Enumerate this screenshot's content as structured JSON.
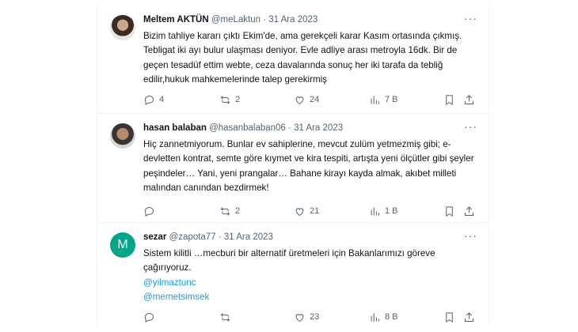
{
  "tweets": [
    {
      "name": "Meltem AKTÜN",
      "handle": "@meLaktun",
      "dot": "·",
      "date": "31 Ara 2023",
      "more": "···",
      "text": "Bizim tahliye kararı çıktı Ekim'de, ama gerekçeli karar Kasım ortasında çıkmış. Tebligat iki ayı bulur ulaşması deniyor. Evle adliye arası metroyla 16dk. Bir de geçen tesadüf ettim webte, ceza davalarında sonuç her iki tarafa da tebliğ edilir,hukuk mahkemelerinde talep gerekirmiş",
      "replies": "4",
      "reposts": "2",
      "likes": "24",
      "views": "7 B"
    },
    {
      "name": "hasan balaban",
      "handle": "@hasanbalaban06",
      "dot": "·",
      "date": "31 Ara 2023",
      "more": "···",
      "text": "Hiç zannetmiyorum.  Bunlar ev sahiplerine, mevcut zulüm yetmezmiş gibi; e-devletten kontrat, semte göre kıymet ve kira tespiti, artışta yeni ölçütler gibi şeyler peşindeler… Yani, yeni prangalar… Bahane kirayı kayda almak, akıbet milleti malından canından bezdirmek!",
      "replies": "",
      "reposts": "2",
      "likes": "21",
      "views": "1 B"
    },
    {
      "name": "sezar",
      "handle": "@zapota77",
      "dot": "·",
      "date": "31 Ara 2023",
      "more": "···",
      "avatar_letter": "M",
      "text": "Sistem kilitli …mecburi bir alternatif üretmeleri için Bakanlarımızı göreve çağırıyoruz.",
      "mentions": [
        "@yilmaztunc",
        "@memetsimsek"
      ],
      "replies": "",
      "reposts": "",
      "likes": "23",
      "views": "8 B"
    }
  ],
  "icons": [
    "reply-icon",
    "repost-icon",
    "like-icon",
    "views-icon",
    "bookmark-icon",
    "share-icon"
  ],
  "colors": {
    "accent": "#1d9bf0",
    "muted": "#536471",
    "divider": "#eff3f4",
    "avatar_m": "#00a58a"
  }
}
